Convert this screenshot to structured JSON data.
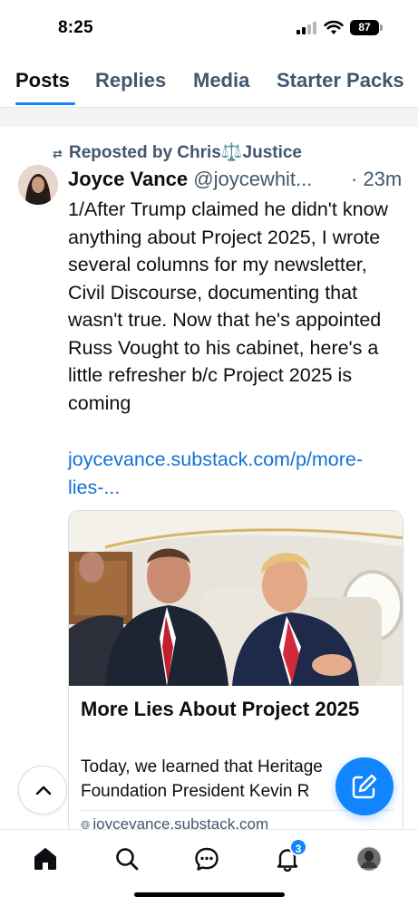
{
  "status_bar": {
    "time": "8:25",
    "battery": "87",
    "icons": [
      "signal-icon",
      "wifi-icon",
      "battery-icon"
    ]
  },
  "tabs": [
    {
      "label": "Posts",
      "active": true
    },
    {
      "label": "Replies",
      "active": false
    },
    {
      "label": "Media",
      "active": false
    },
    {
      "label": "Starter Packs",
      "active": false
    }
  ],
  "post": {
    "repost_label": "Reposted by Chris⚖️Justice",
    "author_name": "Joyce Vance",
    "author_handle": "@joycewhit...",
    "time": "· 23m",
    "text": "1/After Trump claimed he didn't know anything about Project 2025, I wrote several columns for my newsletter, Civil Discourse, documenting that wasn't true. Now that he's appointed Russ Vought to his cabinet, here's a little refresher b/c Project 2025 is coming",
    "link_text": "joycevance.substack.com/p/more-lies-...",
    "card": {
      "title": "More Lies About Project 2025",
      "description": "Today, we learned that Heritage Foundation President Kevin R",
      "domain": "joycevance.substack.com"
    }
  },
  "bottom_nav": {
    "items": [
      "home-icon",
      "search-icon",
      "chat-icon",
      "bell-icon",
      "profile-avatar"
    ],
    "notification_count": "3"
  },
  "colors": {
    "accent": "#1185fe",
    "link": "#1470d6",
    "muted_text": "#42576d"
  }
}
